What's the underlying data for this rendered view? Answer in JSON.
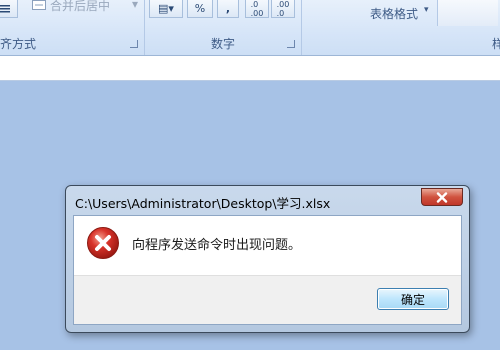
{
  "ribbon": {
    "groups": [
      {
        "label": "齐方式"
      },
      {
        "label": "数字"
      },
      {
        "label": "样"
      }
    ],
    "merge_center_label": "合并后居中",
    "table_format_label": "表格格式",
    "percent_symbol": "%",
    "comma_symbol": ",",
    "inc_decimal_label": ".0→.00",
    "dec_decimal_label": ".00→.0"
  },
  "dialog": {
    "title": "C:\\Users\\Administrator\\Desktop\\学习.xlsx",
    "message": "向程序发送命令时出现问题。",
    "ok_label": "确定",
    "icon": "error-icon",
    "accent_close": "#c9402f",
    "accent_ok_border": "#3c7fb1"
  }
}
